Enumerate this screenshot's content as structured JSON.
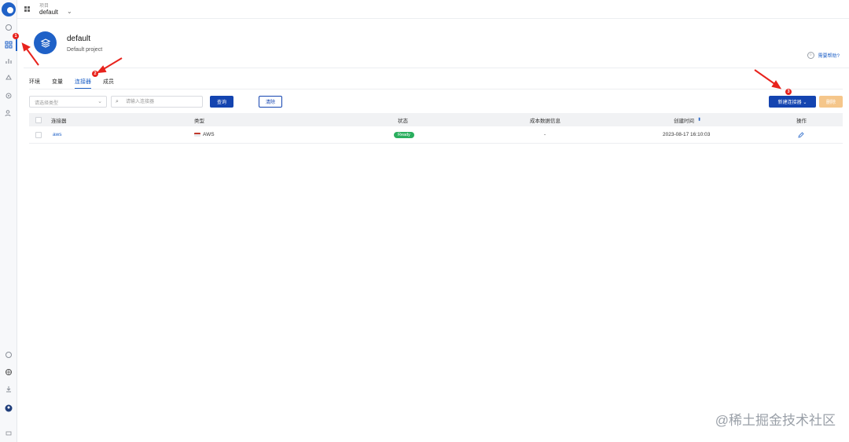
{
  "topbar": {
    "project_label": "项目",
    "project_value": "default"
  },
  "header": {
    "title": "default",
    "subtitle": "Default project",
    "help": "需要帮助?"
  },
  "tabs": [
    {
      "label": "环境"
    },
    {
      "label": "变量"
    },
    {
      "label": "连接器",
      "active": true
    },
    {
      "label": "成员"
    }
  ],
  "filters": {
    "type_placeholder": "请选择类型",
    "search_placeholder": "请输入连接器",
    "query_button": "查询",
    "clear_button": "清除",
    "new_button": "新建连接器",
    "delete_button": "删除"
  },
  "table": {
    "columns": [
      "连接器",
      "类型",
      "状态",
      "成本数据信息",
      "创建时间",
      "操作"
    ],
    "rows": [
      {
        "name": "aws",
        "type": "AWS",
        "status": "Ready",
        "cost": "-",
        "created": "2023-08-17 16:10:03"
      }
    ]
  },
  "annotations": [
    "1",
    "2",
    "3"
  ],
  "watermark": "@稀土掘金技术社区",
  "colors": {
    "primary": "#1444b0",
    "accent": "#1f61c7",
    "ready": "#2aae5e",
    "delete_disabled": "#f5c68a",
    "annotation": "#e8231d"
  }
}
